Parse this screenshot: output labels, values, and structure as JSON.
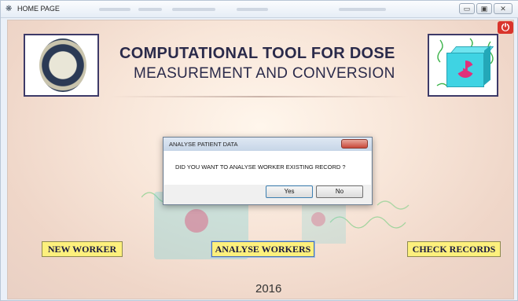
{
  "window": {
    "title": "HOME PAGE",
    "controls": {
      "minimize": "▭",
      "maximize": "▣",
      "close": "✕"
    }
  },
  "header": {
    "title_line1": "COMPUTATIONAL TOOL FOR DOSE",
    "title_line2": "MEASUREMENT AND CONVERSION",
    "left_logo": "university-seal-icon",
    "right_logo": "radiation-cube-icon",
    "power_icon": "power-icon"
  },
  "dialog": {
    "title": "ANALYSE PATIENT DATA",
    "message": "DID YOU WANT TO ANALYSE WORKER EXISTING RECORD ?",
    "yes_label": "Yes",
    "no_label": "No"
  },
  "actions": {
    "new_worker": "NEW WORKER",
    "analyse_workers": "ANALYSE WORKERS",
    "check_records": "CHECK RECORDS"
  },
  "footer": {
    "year": "2016"
  },
  "colors": {
    "button_bg": "#fdf07d",
    "title_text": "#2a2a4a",
    "frame_border": "#3d3a68",
    "power_red": "#d9342b",
    "cube_cyan": "#3fd3e3",
    "radiation_pink": "#e0307a"
  }
}
